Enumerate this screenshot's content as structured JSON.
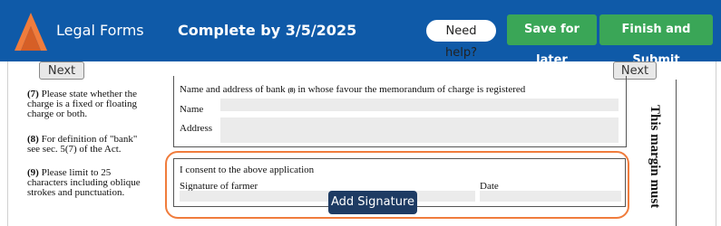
{
  "header": {
    "brand": "Legal Forms",
    "deadline": "Complete by 3/5/2025",
    "help_label": "Need help?",
    "save_label": "Save for later",
    "finish_label": "Finish and Submit",
    "colors": {
      "bar": "#0f5aa8",
      "button": "#3aa657",
      "logo": "#f07c3c"
    }
  },
  "nav": {
    "next_left": "Next",
    "next_right": "Next"
  },
  "notes": [
    {
      "num": "(7)",
      "text": " Please state whether the charge is a fixed or floating charge or both."
    },
    {
      "num": "(8)",
      "text": " For definition of \"bank\" see sec. 5(7) of the Act."
    },
    {
      "num": "(9)",
      "text": " Please limit to 25 characters including oblique strokes and punctuation."
    }
  ],
  "bank_section": {
    "heading": "Name and address of bank",
    "heading_ref": "(8)",
    "heading_rest": " in whose favour the memorandum of charge is registered",
    "name_label": "Name",
    "address_label": "Address"
  },
  "consent_section": {
    "consent_text": "I consent to the above application",
    "signature_label": "Signature of farmer",
    "date_label": "Date",
    "add_signature_label": "Add Signature"
  },
  "margin_text": "This margin must"
}
